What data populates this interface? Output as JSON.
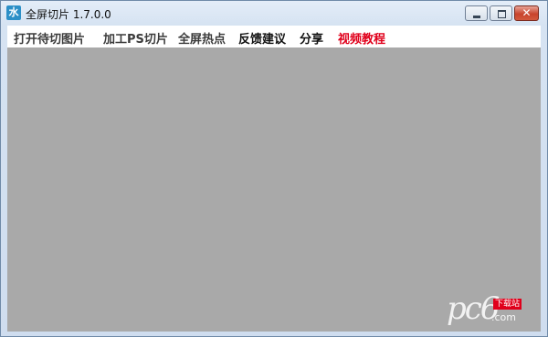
{
  "window": {
    "title": "全屏切片 1.7.0.0",
    "icon_text": "水"
  },
  "controls": {
    "close_glyph": "✕"
  },
  "menu": {
    "items": [
      {
        "label": "打开待切图片"
      },
      {
        "label": "加工PS切片"
      },
      {
        "label": "全屏热点"
      },
      {
        "label": "反馈建议"
      },
      {
        "label": "分享"
      },
      {
        "label": "视频教程"
      }
    ]
  },
  "watermark": {
    "logo": "pc6",
    "tag": "下载站",
    "domain": ".com"
  },
  "colors": {
    "content_bg": "#a9a9a9",
    "accent_red": "#e0001b",
    "menu_bg": "#ffffff"
  }
}
